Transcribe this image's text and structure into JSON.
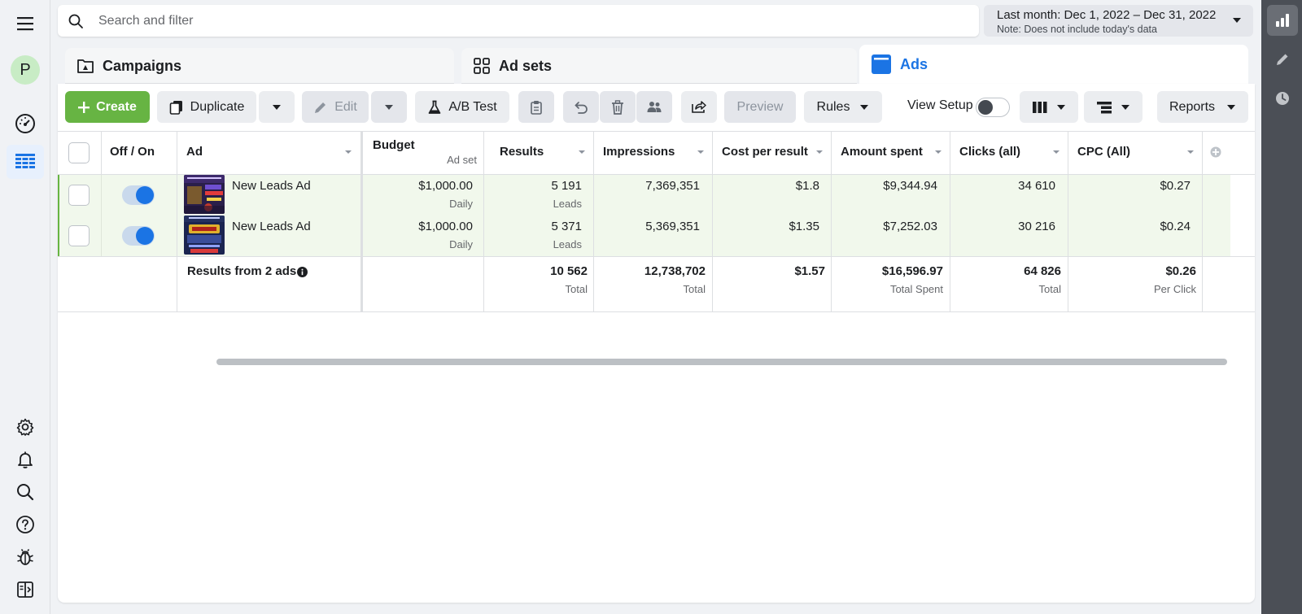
{
  "search": {
    "placeholder": "Search and filter"
  },
  "date_range": {
    "label": "Last month: Dec 1, 2022 – Dec 31, 2022",
    "note": "Note: Does not include today's data"
  },
  "user": {
    "initial": "P"
  },
  "level_tabs": [
    {
      "label": "Campaigns"
    },
    {
      "label": "Ad sets"
    },
    {
      "label": "Ads",
      "active": true
    }
  ],
  "toolbar": {
    "create": "Create",
    "duplicate": "Duplicate",
    "edit": "Edit",
    "ab_test": "A/B Test",
    "preview": "Preview",
    "rules": "Rules",
    "view_setup": "View Setup",
    "reports": "Reports"
  },
  "columns": {
    "off_on": "Off / On",
    "ad": "Ad",
    "budget": "Budget",
    "budget_sub": "Ad set",
    "results": "Results",
    "impressions": "Impressions",
    "cost_per_result": "Cost per result",
    "amount_spent": "Amount spent",
    "clicks": "Clicks (all)",
    "cpc": "CPC (All)"
  },
  "rows": [
    {
      "name": "New Leads Ad",
      "budget": "$1,000.00",
      "budget_type": "Daily",
      "results": "5 191",
      "results_type": "Leads",
      "impressions": "7,369,351",
      "cost_per_result": "$1.8",
      "amount_spent": "$9,344.94",
      "clicks": "34 610",
      "cpc": "$0.27",
      "enabled": true
    },
    {
      "name": "New Leads Ad",
      "budget": "$1,000.00",
      "budget_type": "Daily",
      "results": "5 371",
      "results_type": "Leads",
      "impressions": "5,369,351",
      "cost_per_result": "$1.35",
      "amount_spent": "$7,252.03",
      "clicks": "30 216",
      "cpc": "$0.24",
      "enabled": true
    }
  ],
  "totals": {
    "label": "Results from 2 ads",
    "results": "10 562",
    "results_sub": "Total",
    "impressions": "12,738,702",
    "impressions_sub": "Total",
    "cost_per_result": "$1.57",
    "amount_spent": "$16,596.97",
    "amount_spent_sub": "Total Spent",
    "clicks": "64 826",
    "clicks_sub": "Total",
    "cpc": "$0.26",
    "cpc_sub": "Per Click"
  },
  "colors": {
    "accent": "#1b74e4",
    "create_green": "#67b443",
    "row_highlight": "#f1f8ec",
    "rail_dark": "#4b4f56"
  }
}
